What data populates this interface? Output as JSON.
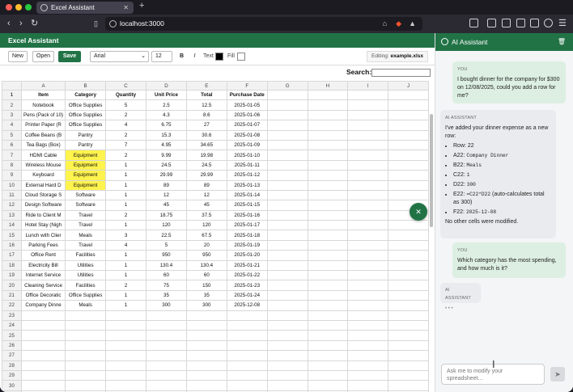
{
  "browser": {
    "tab_title": "Excel Assistant",
    "url": "localhost:3000"
  },
  "app": {
    "title": "Excel Assistant"
  },
  "toolbar": {
    "new_label": "New",
    "open_label": "Open",
    "save_label": "Save",
    "font_family": "Arial",
    "font_size": "12",
    "bold_label": "B",
    "italic_label": "I",
    "text_label": "Text",
    "fill_label": "Fill",
    "text_color": "#000000",
    "fill_color": "#ffffff",
    "editing_label": "Editing:",
    "editing_file": "example.xlsx"
  },
  "search": {
    "label": "Search:",
    "value": ""
  },
  "sheet": {
    "columns": [
      "A",
      "B",
      "C",
      "D",
      "E",
      "F",
      "G",
      "H",
      "I",
      "J"
    ],
    "rows": [
      [
        "Item",
        "Category",
        "Quantity",
        "Unit Price",
        "Total",
        "Purchase Date",
        "",
        "",
        "",
        ""
      ],
      [
        "Notebook",
        "Office Supplies",
        "5",
        "2.5",
        "12.5",
        "2025-01-05",
        "",
        "",
        "",
        ""
      ],
      [
        "Pens (Pack of 10)",
        "Office Supplies",
        "2",
        "4.3",
        "8.6",
        "2025-01-06",
        "",
        "",
        "",
        ""
      ],
      [
        "Printer Paper (R",
        "Office Supplies",
        "4",
        "6.75",
        "27",
        "2025-01-07",
        "",
        "",
        "",
        ""
      ],
      [
        "Coffee Beans (B",
        "Pantry",
        "2",
        "15.3",
        "30.6",
        "2025-01-08",
        "",
        "",
        "",
        ""
      ],
      [
        "Tea Bags (Box)",
        "Pantry",
        "7",
        "4.95",
        "34.65",
        "2025-01-09",
        "",
        "",
        "",
        ""
      ],
      [
        "HDMI Cable",
        "Equipment",
        "2",
        "9.99",
        "19.98",
        "2025-01-10",
        "",
        "",
        "",
        ""
      ],
      [
        "Wireless Mouse",
        "Equipment",
        "1",
        "24.5",
        "24.5",
        "2025-01-11",
        "",
        "",
        "",
        ""
      ],
      [
        "Keyboard",
        "Equipment",
        "1",
        "29.99",
        "29.99",
        "2025-01-12",
        "",
        "",
        "",
        ""
      ],
      [
        "External Hard D",
        "Equipment",
        "1",
        "89",
        "89",
        "2025-01-13",
        "",
        "",
        "",
        ""
      ],
      [
        "Cloud Storage S",
        "Software",
        "1",
        "12",
        "12",
        "2025-01-14",
        "",
        "",
        "",
        ""
      ],
      [
        "Design Software",
        "Software",
        "1",
        "45",
        "45",
        "2025-01-15",
        "",
        "",
        "",
        ""
      ],
      [
        "Ride to Client M",
        "Travel",
        "2",
        "18.75",
        "37.5",
        "2025-01-16",
        "",
        "",
        "",
        ""
      ],
      [
        "Hotel Stay (Nigh",
        "Travel",
        "1",
        "120",
        "120",
        "2025-01-17",
        "",
        "",
        "",
        ""
      ],
      [
        "Lunch with Clier",
        "Meals",
        "3",
        "22.5",
        "67.5",
        "2025-01-18",
        "",
        "",
        "",
        ""
      ],
      [
        "Parking Fees",
        "Travel",
        "4",
        "5",
        "20",
        "2025-01-19",
        "",
        "",
        "",
        ""
      ],
      [
        "Office Rent",
        "Facilities",
        "1",
        "950",
        "950",
        "2025-01-20",
        "",
        "",
        "",
        ""
      ],
      [
        "Electricity Bill",
        "Utilities",
        "1",
        "130.4",
        "130.4",
        "2025-01-21",
        "",
        "",
        "",
        ""
      ],
      [
        "Internet Service",
        "Utilities",
        "1",
        "60",
        "60",
        "2025-01-22",
        "",
        "",
        "",
        ""
      ],
      [
        "Cleaning Service",
        "Facilities",
        "2",
        "75",
        "150",
        "2025-01-23",
        "",
        "",
        "",
        ""
      ],
      [
        "Office Decoratic",
        "Office Supplies",
        "1",
        "35",
        "35",
        "2025-01-24",
        "",
        "",
        "",
        ""
      ],
      [
        "Company Dinne",
        "Meals",
        "1",
        "300",
        "300",
        "2025-12-08",
        "",
        "",
        "",
        ""
      ],
      [
        "",
        "",
        "",
        "",
        "",
        "",
        "",
        "",
        "",
        ""
      ],
      [
        "",
        "",
        "",
        "",
        "",
        "",
        "",
        "",
        "",
        ""
      ],
      [
        "",
        "",
        "",
        "",
        "",
        "",
        "",
        "",
        "",
        ""
      ],
      [
        "",
        "",
        "",
        "",
        "",
        "",
        "",
        "",
        "",
        ""
      ],
      [
        "",
        "",
        "",
        "",
        "",
        "",
        "",
        "",
        "",
        ""
      ],
      [
        "",
        "",
        "",
        "",
        "",
        "",
        "",
        "",
        "",
        ""
      ],
      [
        "",
        "",
        "",
        "",
        "",
        "",
        "",
        "",
        "",
        ""
      ],
      [
        "",
        "",
        "",
        "",
        "",
        "",
        "",
        "",
        "",
        ""
      ],
      [
        "",
        "",
        "",
        "",
        "",
        "",
        "",
        "",
        "",
        ""
      ],
      [
        "",
        "",
        "",
        "",
        "",
        "",
        "",
        "",
        "",
        ""
      ]
    ],
    "highlight_color": "#fff34d"
  },
  "assistant": {
    "title": "AI Assistant",
    "user_label": "YOU",
    "ai_label": "AI ASSISTANT",
    "msg1": "I bought dinner for the company for $300 on 12/08/2025, could you add a row for me?",
    "msg2_intro": "I've added your dinner expense as a new row:",
    "msg2_items": [
      {
        "key": "Row: 22",
        "val": ""
      },
      {
        "key": "A22: ",
        "val": "Company Dinner"
      },
      {
        "key": "B22: ",
        "val": "Meals"
      },
      {
        "key": "C22: ",
        "val": "1"
      },
      {
        "key": "D22: ",
        "val": "300"
      },
      {
        "key": "E22: ",
        "val": "=C22*D22",
        "extra": " (auto-calculates total as 300)"
      },
      {
        "key": "F22: ",
        "val": "2025-12-08"
      }
    ],
    "msg2_outro": "No other cells were modified.",
    "msg3": "Which category has the most spending, and how much is it?",
    "typing": "• • •",
    "input_placeholder": "Ask me to modify your spreadsheet..."
  }
}
